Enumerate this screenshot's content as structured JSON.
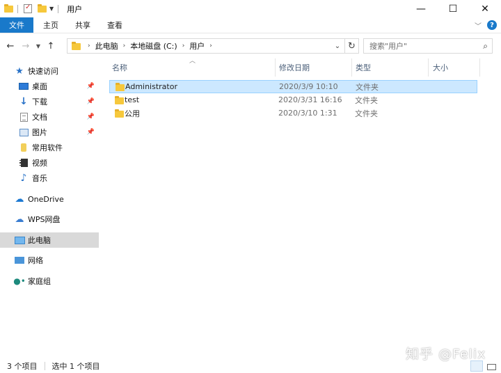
{
  "window": {
    "title": "用户",
    "controls": {
      "minimize": "—",
      "maximize": "☐",
      "close": "✕"
    }
  },
  "ribbon": {
    "tabs": [
      "文件",
      "主页",
      "共享",
      "查看"
    ],
    "expand_icon": "chevron-down-icon",
    "help_label": "?"
  },
  "address": {
    "breadcrumbs": [
      "此电脑",
      "本地磁盘 (C:)",
      "用户"
    ]
  },
  "search": {
    "placeholder": "搜索\"用户\""
  },
  "sidebar": {
    "quick_access": "快速访问",
    "pinned": [
      {
        "label": "桌面",
        "icon": "desktop-icon",
        "pinned": true
      },
      {
        "label": "下载",
        "icon": "download-icon",
        "pinned": true
      },
      {
        "label": "文档",
        "icon": "document-icon",
        "pinned": true
      },
      {
        "label": "图片",
        "icon": "picture-icon",
        "pinned": true
      },
      {
        "label": "常用软件",
        "icon": "folder-icon",
        "pinned": false
      },
      {
        "label": "视频",
        "icon": "video-icon",
        "pinned": false
      },
      {
        "label": "音乐",
        "icon": "music-icon",
        "pinned": false
      }
    ],
    "onedrive": "OneDrive",
    "wps": "WPS网盘",
    "this_pc": "此电脑",
    "network": "网络",
    "homegroup": "家庭组"
  },
  "columns": {
    "name": "名称",
    "modified": "修改日期",
    "type": "类型",
    "size": "大小"
  },
  "files": [
    {
      "name": "Administrator",
      "modified": "2020/3/9 10:10",
      "type": "文件夹",
      "selected": true
    },
    {
      "name": "test",
      "modified": "2020/3/31 16:16",
      "type": "文件夹",
      "selected": false
    },
    {
      "name": "公用",
      "modified": "2020/3/10 1:31",
      "type": "文件夹",
      "selected": false
    }
  ],
  "status": {
    "count": "3 个项目",
    "selection": "选中 1 个项目"
  },
  "watermark": "知乎 @Felix",
  "colors": {
    "accent": "#1979ca",
    "selection": "#cce8ff",
    "folder": "#f6c83c"
  }
}
